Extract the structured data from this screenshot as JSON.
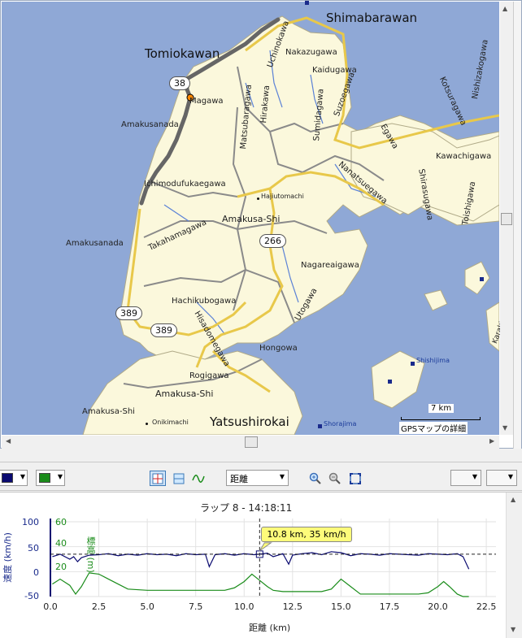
{
  "map": {
    "labels_big": [
      "Shimabarawan",
      "Tomiokawan",
      "Yatsushirokai"
    ],
    "labels": [
      "Uchinokawa",
      "Nakazugawa",
      "Kaidugawa",
      "Suzoegawa",
      "Matsubaragawa",
      "Hirakawa",
      "Sumidagawa",
      "Magawa",
      "Amakusanada",
      "Egawa",
      "Kotsuragawa",
      "Nishizakogawa",
      "Kawachigawa",
      "Shirasugawa",
      "Nanatsuegawa",
      "Toishigawa",
      "Ichimodufukaegawa",
      "Hajiutomachi",
      "Amakusa-Shi",
      "Takahamagawa",
      "Amakusanada",
      "Nagareaigawa",
      "Hachikubogawa",
      "Utogawa",
      "Hisadomegawa",
      "Hongowa",
      "Rogigawa",
      "Amakusa-Shi",
      "Amakusa-Shi",
      "Onikimachi",
      "Karakizaki"
    ],
    "route_shields": [
      "38",
      "266",
      "389",
      "389"
    ],
    "poi": [
      "Shishijima",
      "Shorajima"
    ],
    "scale": "7 km",
    "attribution": "GPSマップの詳細",
    "colors": {
      "sea": "#8fa8d6",
      "land": "#fbf8dc",
      "road": "#e8c84a",
      "track": "#666666"
    }
  },
  "toolbar": {
    "color1": "#0a0a70",
    "color2": "#1a8c1a",
    "xaxis_value": "距離",
    "icons": [
      "crosshair-icon",
      "split-icon",
      "wave-icon",
      "zoom-in-icon",
      "zoom-out-icon",
      "fit-icon"
    ]
  },
  "chart": {
    "title": "ラップ 8 - 14:18:11",
    "ylabel_left": "速度 (km/h)",
    "ylabel_right": "標高 (m)",
    "xlabel": "距離 (km)",
    "left_ticks": [
      "100",
      "50",
      "0",
      "-50"
    ],
    "right_ticks": [
      "60",
      "40",
      "20"
    ],
    "x_ticks": [
      "0.0",
      "2.5",
      "5.0",
      "7.5",
      "10.0",
      "12.5",
      "15.0",
      "17.5",
      "20.0",
      "22.5"
    ],
    "tooltip": "10.8 km, 35 km/h"
  },
  "chart_data": {
    "type": "line",
    "title": "ラップ 8 - 14:18:11",
    "xlabel": "距離 (km)",
    "ylabel": "速度 (km/h)",
    "xlim": [
      0,
      23
    ],
    "ylim": [
      -50,
      100
    ],
    "x_ticks": [
      0.0,
      2.5,
      5.0,
      7.5,
      10.0,
      12.5,
      15.0,
      17.5,
      20.0,
      22.5
    ],
    "series": [
      {
        "name": "速度 (km/h)",
        "color": "#0a0a70",
        "x": [
          0.1,
          0.5,
          1.0,
          1.2,
          1.4,
          1.6,
          2.0,
          2.5,
          3.0,
          3.5,
          4.0,
          4.5,
          5.0,
          5.5,
          6.0,
          6.5,
          7.0,
          7.5,
          8.0,
          8.2,
          8.5,
          9.0,
          9.5,
          10.0,
          10.5,
          10.8,
          11.2,
          11.5,
          12.0,
          12.3,
          12.5,
          13.0,
          13.5,
          14.0,
          14.5,
          15.0,
          15.5,
          16.0,
          16.5,
          17.0,
          17.5,
          18.0,
          18.5,
          19.0,
          19.5,
          20.0,
          20.5,
          21.0,
          21.3,
          21.6
        ],
        "values": [
          30,
          35,
          25,
          30,
          20,
          28,
          33,
          34,
          36,
          32,
          35,
          33,
          36,
          34,
          35,
          32,
          36,
          34,
          35,
          10,
          34,
          36,
          33,
          36,
          34,
          35,
          37,
          30,
          36,
          15,
          33,
          36,
          38,
          34,
          40,
          38,
          32,
          36,
          35,
          33,
          36,
          35,
          34,
          33,
          36,
          35,
          34,
          36,
          30,
          5
        ]
      },
      {
        "name": "標高 (m)",
        "color": "#1a8c1a",
        "x": [
          0.1,
          0.5,
          1.0,
          1.3,
          1.6,
          2.0,
          2.5,
          3.0,
          3.5,
          4.0,
          5.0,
          6.0,
          7.0,
          8.0,
          9.0,
          9.5,
          10.0,
          10.4,
          10.8,
          11.2,
          11.5,
          12.0,
          13.0,
          14.0,
          14.5,
          15.0,
          15.5,
          16.0,
          17.0,
          18.0,
          19.0,
          19.5,
          20.0,
          20.3,
          20.6,
          21.0,
          21.3,
          21.6
        ],
        "values": [
          10,
          14,
          9,
          2,
          8,
          19,
          18,
          14,
          10,
          6,
          5,
          5,
          5,
          5,
          5,
          7,
          12,
          18,
          13,
          8,
          5,
          4,
          4,
          4,
          6,
          14,
          8,
          2,
          2,
          2,
          2,
          3,
          8,
          12,
          8,
          2,
          0,
          0
        ]
      }
    ],
    "cursor": {
      "x": 10.8,
      "speed": 35,
      "label": "10.8 km, 35 km/h"
    }
  }
}
